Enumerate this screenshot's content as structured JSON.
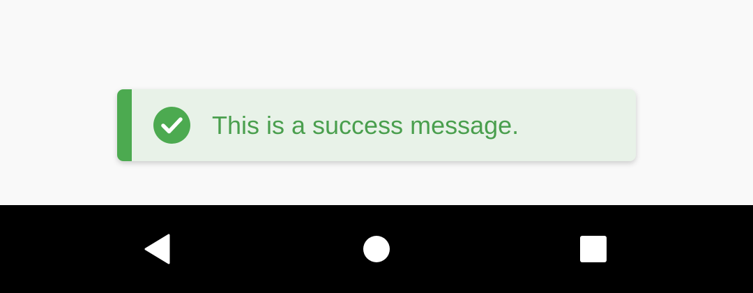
{
  "toast": {
    "message": "This is a success message.",
    "icon": "check-circle-icon",
    "accent_color": "#4caa50",
    "background_color": "#e8f2e8",
    "text_color": "#4a9f4e"
  },
  "navigation_bar": {
    "back_icon": "back-triangle-icon",
    "home_icon": "home-circle-icon",
    "recents_icon": "recents-square-icon",
    "background_color": "#000000",
    "icon_color": "#ffffff"
  }
}
